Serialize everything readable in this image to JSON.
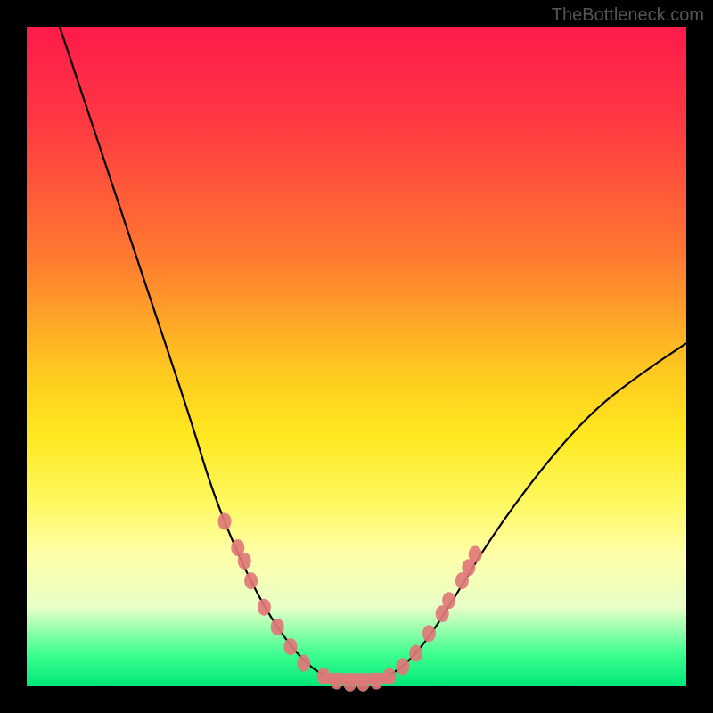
{
  "watermark": "TheBottleneck.com",
  "chart_data": {
    "type": "line",
    "title": "",
    "xlabel": "",
    "ylabel": "",
    "xlim": [
      0,
      100
    ],
    "ylim": [
      0,
      100
    ],
    "grid": false,
    "legend": false,
    "background_gradient": {
      "direction": "vertical",
      "stops": [
        {
          "pct": 0,
          "color": "#ff1a4a"
        },
        {
          "pct": 0.35,
          "color": "#ff7a30"
        },
        {
          "pct": 0.62,
          "color": "#ffe820"
        },
        {
          "pct": 0.8,
          "color": "#ffffa8"
        },
        {
          "pct": 0.95,
          "color": "#40ff90"
        },
        {
          "pct": 1.0,
          "color": "#00e878"
        }
      ]
    },
    "series": [
      {
        "name": "bottleneck-curve",
        "color": "#000000",
        "points": [
          {
            "x": 5,
            "y": 100
          },
          {
            "x": 10,
            "y": 85
          },
          {
            "x": 15,
            "y": 70
          },
          {
            "x": 20,
            "y": 55
          },
          {
            "x": 25,
            "y": 40
          },
          {
            "x": 28,
            "y": 30
          },
          {
            "x": 32,
            "y": 20
          },
          {
            "x": 36,
            "y": 12
          },
          {
            "x": 40,
            "y": 6
          },
          {
            "x": 44,
            "y": 2
          },
          {
            "x": 48,
            "y": 0.5
          },
          {
            "x": 52,
            "y": 0.5
          },
          {
            "x": 56,
            "y": 2
          },
          {
            "x": 60,
            "y": 6
          },
          {
            "x": 64,
            "y": 12
          },
          {
            "x": 70,
            "y": 22
          },
          {
            "x": 78,
            "y": 33
          },
          {
            "x": 86,
            "y": 42
          },
          {
            "x": 94,
            "y": 48
          },
          {
            "x": 100,
            "y": 52
          }
        ]
      }
    ],
    "markers": {
      "color": "#e07878",
      "shape": "ellipse",
      "points": [
        {
          "x": 30,
          "y": 25
        },
        {
          "x": 32,
          "y": 21
        },
        {
          "x": 33,
          "y": 19
        },
        {
          "x": 34,
          "y": 16
        },
        {
          "x": 36,
          "y": 12
        },
        {
          "x": 38,
          "y": 9
        },
        {
          "x": 40,
          "y": 6
        },
        {
          "x": 42,
          "y": 3.5
        },
        {
          "x": 45,
          "y": 1.5
        },
        {
          "x": 47,
          "y": 0.8
        },
        {
          "x": 49,
          "y": 0.5
        },
        {
          "x": 51,
          "y": 0.5
        },
        {
          "x": 53,
          "y": 0.8
        },
        {
          "x": 55,
          "y": 1.5
        },
        {
          "x": 57,
          "y": 3
        },
        {
          "x": 59,
          "y": 5
        },
        {
          "x": 61,
          "y": 8
        },
        {
          "x": 63,
          "y": 11
        },
        {
          "x": 64,
          "y": 13
        },
        {
          "x": 66,
          "y": 16
        },
        {
          "x": 67,
          "y": 18
        },
        {
          "x": 68,
          "y": 20
        }
      ]
    }
  }
}
